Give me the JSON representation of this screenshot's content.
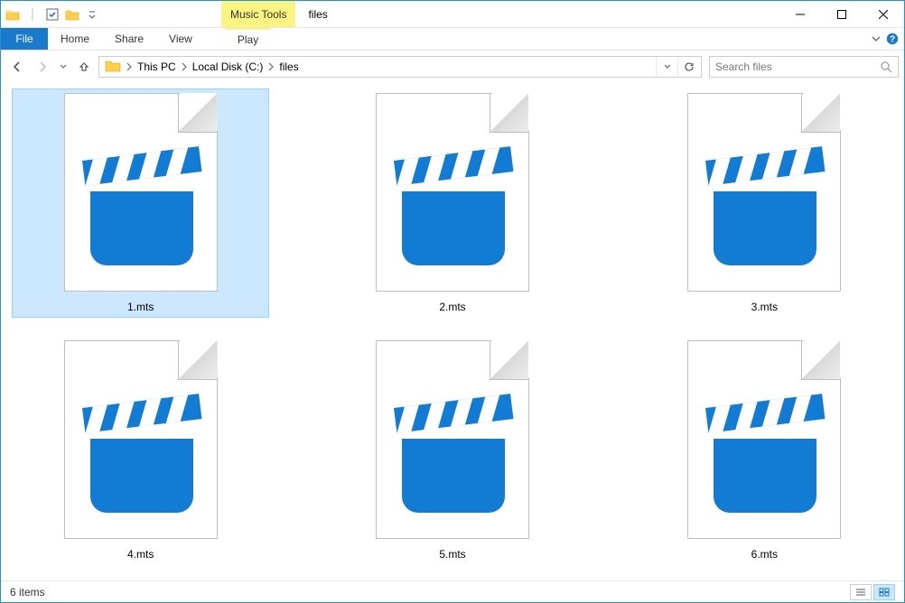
{
  "window": {
    "title": "files",
    "context_tab": "Music Tools"
  },
  "ribbon": {
    "file": "File",
    "tabs": [
      "Home",
      "Share",
      "View"
    ],
    "context_tabs": [
      "Play"
    ]
  },
  "breadcrumb": {
    "segments": [
      "This PC",
      "Local Disk (C:)",
      "files"
    ]
  },
  "search": {
    "placeholder": "Search files"
  },
  "files": [
    {
      "name": "1.mts",
      "selected": true
    },
    {
      "name": "2.mts",
      "selected": false
    },
    {
      "name": "3.mts",
      "selected": false
    },
    {
      "name": "4.mts",
      "selected": false
    },
    {
      "name": "5.mts",
      "selected": false
    },
    {
      "name": "6.mts",
      "selected": false
    }
  ],
  "status": {
    "text": "6 items"
  }
}
